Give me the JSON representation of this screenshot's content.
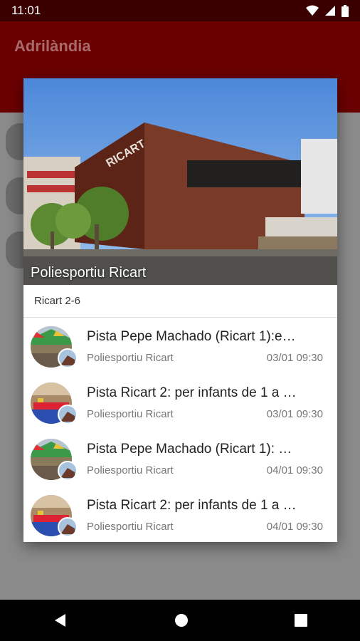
{
  "status_bar": {
    "time": "11:01",
    "icons": [
      "wifi-icon",
      "signal-icon",
      "battery-icon"
    ]
  },
  "app": {
    "title": "Adrilàndia"
  },
  "dialog": {
    "hero_title": "Poliesportiu Ricart",
    "building_sign": "RICART",
    "subheader": "Ricart 2-6",
    "events": [
      {
        "title": "Pista Pepe Machado (Ricart 1):e…",
        "venue": "Poliesportiu Ricart",
        "date": "03/01 09:30"
      },
      {
        "title": "Pista Ricart 2: per infants de 1 a …",
        "venue": "Poliesportiu Ricart",
        "date": "03/01 09:30"
      },
      {
        "title": "Pista Pepe Machado (Ricart 1): …",
        "venue": "Poliesportiu Ricart",
        "date": "04/01 09:30"
      },
      {
        "title": "Pista Ricart 2: per infants de 1 a …",
        "venue": "Poliesportiu Ricart",
        "date": "04/01 09:30"
      }
    ]
  },
  "nav": {
    "buttons": [
      "back-icon",
      "home-icon",
      "recents-icon"
    ]
  },
  "colors": {
    "status_bar": "#3a0000",
    "app_bar": "#6b0000",
    "scrim": "#8a8a8a"
  }
}
